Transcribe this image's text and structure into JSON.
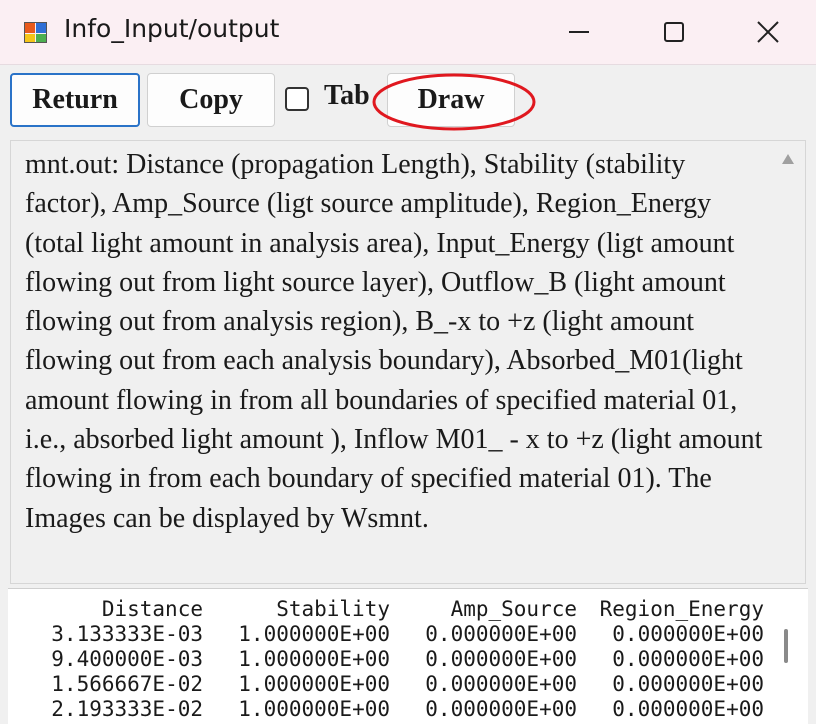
{
  "window": {
    "title": "Info_Input/output"
  },
  "toolbar": {
    "return_label": "Return",
    "copy_label": "Copy",
    "tab_label": "Tab",
    "tab_checked": false,
    "draw_label": "Draw",
    "annotation_color": "#e0181f"
  },
  "info": {
    "text": "mnt.out: Distance (propagation Length), Stability (stability factor), Amp_Source (ligt source amplitude), Region_Energy (total light amount in analysis area), Input_Energy (ligt amount flowing out from light source layer), Outflow_B (light amount flowing out from analysis region), B_-x to +z (light amount flowing out from each analysis boundary), Absorbed_M01(light amount flowing in from all boundaries of specified material 01, i.e., absorbed light amount ), Inflow M01_ - x to +z (light amount flowing in from each boundary of specified material 01). The Images can be displayed by Wsmnt."
  },
  "table": {
    "headers": [
      "Distance",
      "Stability",
      "Amp_Source",
      "Region_Energy"
    ],
    "rows": [
      [
        "3.133333E-03",
        "1.000000E+00",
        "0.000000E+00",
        "0.000000E+00"
      ],
      [
        "9.400000E-03",
        "1.000000E+00",
        "0.000000E+00",
        "0.000000E+00"
      ],
      [
        "1.566667E-02",
        "1.000000E+00",
        "0.000000E+00",
        "0.000000E+00"
      ],
      [
        "2.193333E-02",
        "1.000000E+00",
        "0.000000E+00",
        "0.000000E+00"
      ]
    ]
  }
}
